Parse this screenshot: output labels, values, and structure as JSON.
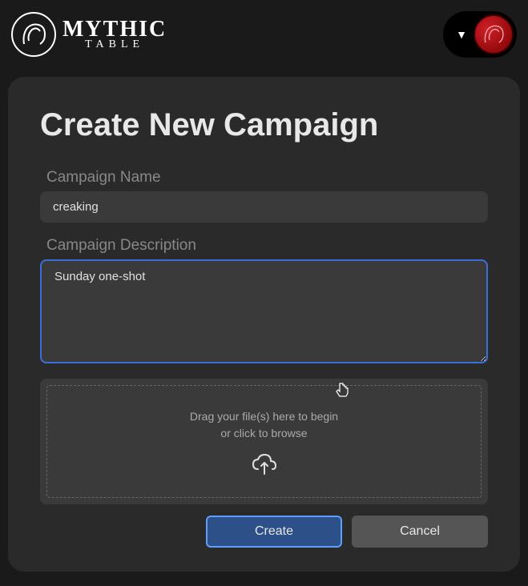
{
  "brand": {
    "main": "MYTHIC",
    "sub": "TABLE"
  },
  "page": {
    "title": "Create New Campaign"
  },
  "form": {
    "name_label": "Campaign Name",
    "name_value": "creaking",
    "desc_label": "Campaign Description",
    "desc_value": "Sunday one-shot",
    "drop_line1": "Drag your file(s) here to begin",
    "drop_line2": "or click to browse"
  },
  "buttons": {
    "create": "Create",
    "cancel": "Cancel"
  }
}
